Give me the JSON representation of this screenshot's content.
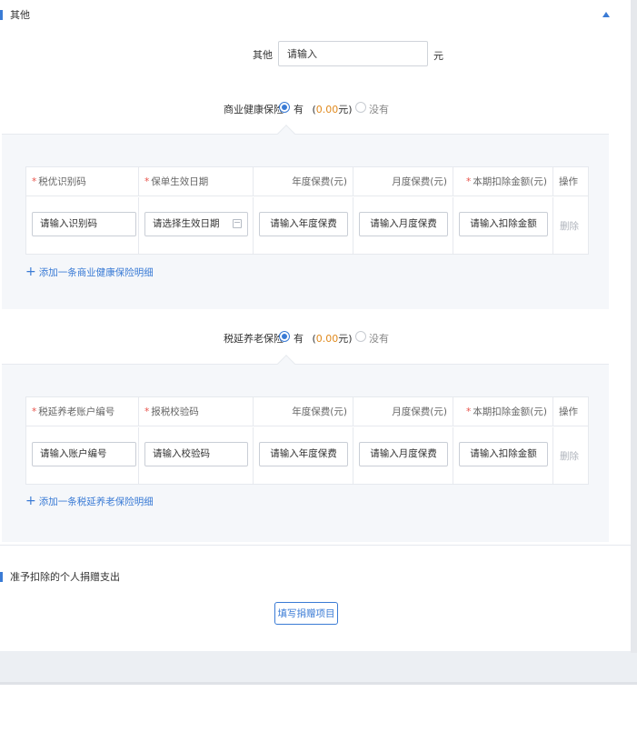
{
  "section_other": {
    "title": "其他"
  },
  "other_field": {
    "label": "其他",
    "placeholder": "请输入",
    "unit": "元"
  },
  "health_insurance": {
    "label": "商业健康保险",
    "yes_label": "有",
    "amount_open": "(",
    "amount": "0.00",
    "amount_close": "元)",
    "no_label": "没有",
    "selected": "有",
    "columns": [
      "税优识别码",
      "保单生效日期",
      "年度保费(元)",
      "月度保费(元)",
      "本期扣除金额(元)",
      "操作"
    ],
    "row_placeholders": [
      "请输入识别码",
      "请选择生效日期",
      "请输入年度保费",
      "请输入月度保费",
      "请输入扣除金额"
    ],
    "delete_label": "删除",
    "add_link": "添加一条商业健康保险明细"
  },
  "pension_insurance": {
    "label": "税延养老保险",
    "yes_label": "有",
    "amount_open": "(",
    "amount": "0.00",
    "amount_close": "元)",
    "no_label": "没有",
    "selected": "有",
    "columns": [
      "税延养老账户编号",
      "报税校验码",
      "年度保费(元)",
      "月度保费(元)",
      "本期扣除金额(元)",
      "操作"
    ],
    "row_placeholders": [
      "请输入账户编号",
      "请输入校验码",
      "请输入年度保费",
      "请输入月度保费",
      "请输入扣除金额"
    ],
    "delete_label": "删除",
    "add_link": "添加一条税延养老保险明细"
  },
  "section_donation": {
    "title": "准予扣除的个人捐赠支出",
    "button": "填写捐赠项目"
  },
  "colors": {
    "accent": "#3a7bd5",
    "amount": "#e08a1e",
    "required": "#e8524a"
  },
  "icons": [
    "collapse-up-icon",
    "calendar-icon",
    "plus-icon"
  ]
}
